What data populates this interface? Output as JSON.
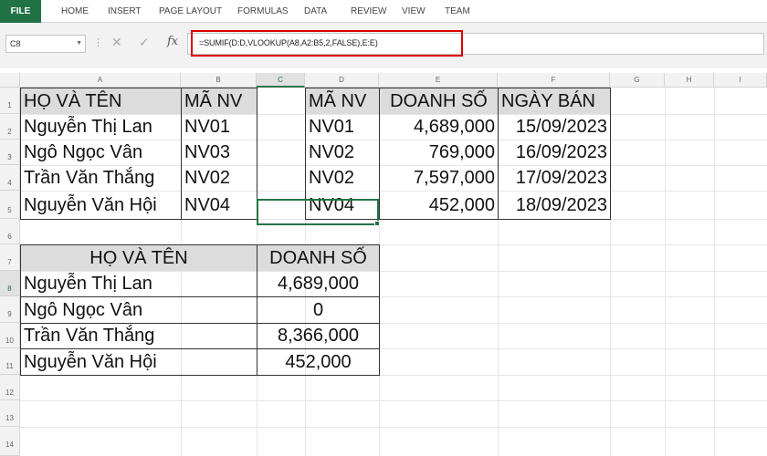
{
  "ribbon": {
    "tabs": [
      "FILE",
      "HOME",
      "INSERT",
      "PAGE LAYOUT",
      "FORMULAS",
      "DATA",
      "REVIEW",
      "VIEW",
      "TEAM"
    ]
  },
  "formula_bar": {
    "name_box": "C8",
    "formula": "=SUMIF(D:D,VLOOKUP(A8,A2:B5,2,FALSE),E:E)",
    "cancel_icon": "close-icon",
    "enter_icon": "check-icon",
    "fx_label": "fx",
    "highlight_color": "#e00000"
  },
  "sheet": {
    "columns": [
      "A",
      "B",
      "C",
      "D",
      "E",
      "F",
      "G",
      "H",
      "I"
    ],
    "rows": [
      "1",
      "2",
      "3",
      "4",
      "5",
      "6",
      "7",
      "8",
      "9",
      "10",
      "11",
      "12",
      "13",
      "14"
    ],
    "selected_column": "C",
    "selected_row": "8",
    "accent_color": "#217346",
    "header_fill": "#dcdcdc",
    "table1": {
      "headers": [
        "HỌ VÀ TÊN",
        "MÃ NV"
      ],
      "rows": [
        [
          "Nguyễn Thị Lan",
          "NV01"
        ],
        [
          "Ngô Ngọc Vân",
          "NV03"
        ],
        [
          "Trần Văn Thắng",
          "NV02"
        ],
        [
          "Nguyễn Văn Hội",
          "NV04"
        ]
      ]
    },
    "table2": {
      "headers": [
        "MÃ NV",
        "DOANH SỐ",
        "NGÀY BÁN"
      ],
      "rows": [
        [
          "NV01",
          "4,689,000",
          "15/09/2023"
        ],
        [
          "NV02",
          "769,000",
          "16/09/2023"
        ],
        [
          "NV02",
          "7,597,000",
          "17/09/2023"
        ],
        [
          "NV04",
          "452,000",
          "18/09/2023"
        ]
      ]
    },
    "table3": {
      "headers": [
        "HỌ VÀ TÊN",
        "DOANH SỐ"
      ],
      "rows": [
        [
          "Nguyễn Thị Lan",
          "4,689,000"
        ],
        [
          "Ngô Ngọc Vân",
          "0"
        ],
        [
          "Trần Văn Thắng",
          "8,366,000"
        ],
        [
          "Nguyễn Văn Hội",
          "452,000"
        ]
      ]
    }
  }
}
